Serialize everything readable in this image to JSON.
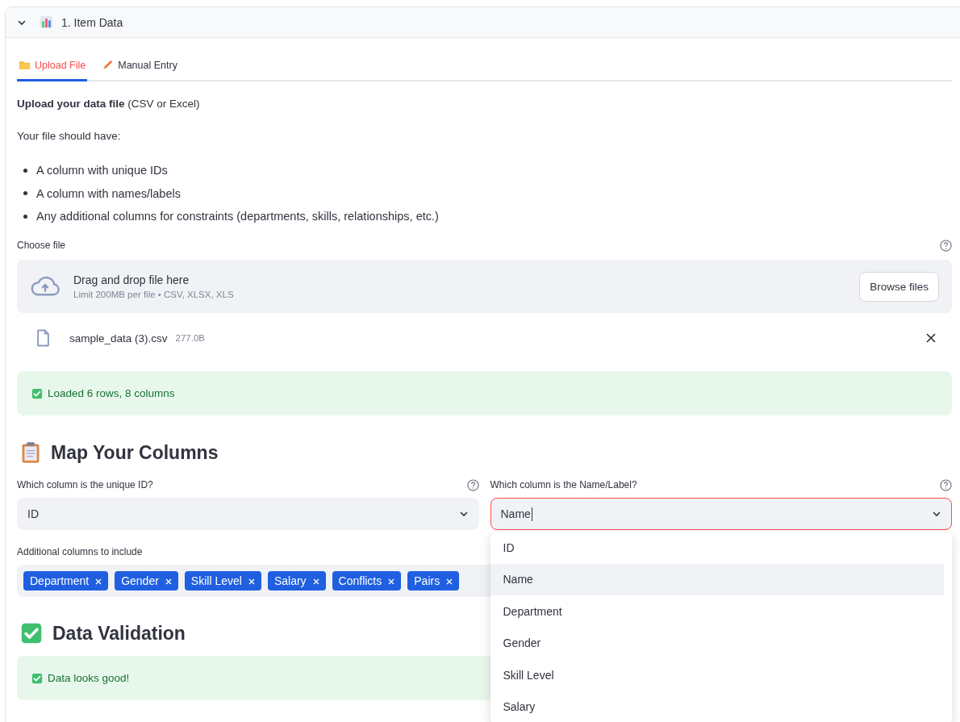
{
  "expander": {
    "title": "1. Item Data",
    "expanded": true
  },
  "tabs": [
    {
      "label": "Upload File",
      "selected": true
    },
    {
      "label": "Manual Entry",
      "selected": false
    }
  ],
  "intro": {
    "heading": "**Upload your data file** (CSV or Excel)",
    "lead": "Your file should have:",
    "bullets": [
      "A column with unique IDs",
      "A column with names/labels",
      "Any additional columns for constraints (departments, skills, relationships, etc.)"
    ]
  },
  "uploader": {
    "label": "Choose file",
    "drop_text": "Drag and drop file here",
    "limit_text": "Limit 200MB per file • CSV, XLSX, XLS",
    "browse_button": "Browse files",
    "file": {
      "name": "sample_data (3).csv",
      "size": "277.0B"
    }
  },
  "load_alert": {
    "text": "Loaded 6 rows, 8 columns"
  },
  "map_section": {
    "title": "Map Your Columns",
    "id_select": {
      "label": "Which column is the unique ID?",
      "value": "ID"
    },
    "name_select": {
      "label": "Which column is the Name/Label?",
      "value": "Name",
      "focused": true,
      "open": true,
      "options": [
        {
          "label": "ID",
          "selected": false
        },
        {
          "label": "Name",
          "selected": true
        },
        {
          "label": "Department",
          "selected": false
        },
        {
          "label": "Gender",
          "selected": false
        },
        {
          "label": "Skill Level",
          "selected": false
        },
        {
          "label": "Salary",
          "selected": false
        }
      ]
    },
    "extra_columns": {
      "label": "Additional columns to include",
      "tags": [
        "Department",
        "Gender",
        "Skill Level",
        "Salary",
        "Conflicts",
        "Pairs"
      ]
    }
  },
  "validation": {
    "title": "Data Validation",
    "alert": "Data looks good!"
  }
}
